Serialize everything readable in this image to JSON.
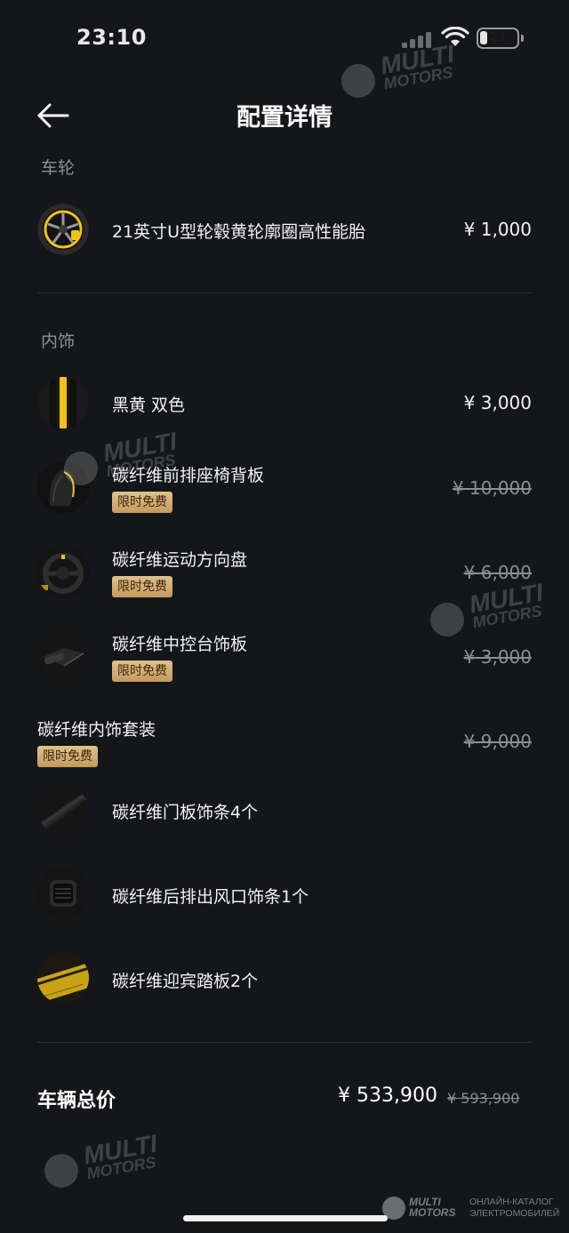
{
  "status_bar": {
    "time": "23:10",
    "battery": "21",
    "battery_level_percent": 21
  },
  "header": {
    "title": "配置详情",
    "back_icon": "arrow-left-icon"
  },
  "sections": {
    "wheels": {
      "label": "车轮",
      "items": [
        {
          "name": "21英寸U型轮毂黄轮廓圈高性能胎",
          "price": "¥ 1,000",
          "thumb": "wheel-thumbnail"
        }
      ]
    },
    "interior": {
      "label": "内饰",
      "items": [
        {
          "name": "黑黄 双色",
          "price": "¥ 3,000",
          "thumb": "black-yellow-swatch"
        },
        {
          "name": "碳纤维前排座椅背板",
          "price": "¥ 10,000",
          "badge": "限时免费",
          "thumb": "seat-back-thumbnail"
        },
        {
          "name": "碳纤维运动方向盘",
          "price": "¥ 6,000",
          "badge": "限时免费",
          "thumb": "steering-wheel-thumbnail"
        },
        {
          "name": "碳纤维中控台饰板",
          "price": "¥ 3,000",
          "badge": "限时免费",
          "thumb": "console-thumbnail"
        }
      ],
      "package": {
        "name": "碳纤维内饰套装",
        "price": "¥ 9,000",
        "badge": "限时免费",
        "items": [
          {
            "name": "碳纤维门板饰条4个",
            "thumb": "door-trim-thumbnail"
          },
          {
            "name": "碳纤维后排出风口饰条1个",
            "thumb": "air-vent-thumbnail"
          },
          {
            "name": "碳纤维迎宾踏板2个",
            "thumb": "sill-plate-thumbnail"
          }
        ]
      }
    }
  },
  "total": {
    "label": "车辆总价",
    "price": "¥ 533,900",
    "original_price": "¥ 593,900"
  },
  "watermark": {
    "line1": "MULTI",
    "line2": "MOTORS",
    "brand_tag_line1": "ОНЛАЙН-КАТАЛОГ",
    "brand_tag_line2": "ЭЛЕКТРОМОБИЛЕЙ"
  },
  "colors": {
    "background": "#141619",
    "badge_gold": "#d6b07a",
    "accent_yellow": "#f2c21b"
  }
}
